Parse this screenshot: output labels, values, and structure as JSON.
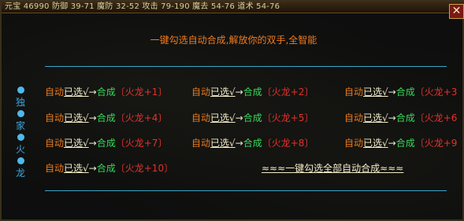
{
  "status_bar": {
    "text": "元宝  46990 防御 39-71 魔防 32-52 攻击 79-190 魔去 54-76 道术 54-76"
  },
  "close_label": "✕",
  "heading": "一键勾选自动合成,解放你的双手,全智能",
  "side_label": [
    "独",
    "家",
    "火",
    "龙"
  ],
  "rows": [
    [
      {
        "auto": "自动",
        "selected": "已选√",
        "arrow": "→",
        "combine": "合成",
        "item": "〔火龙+1〕"
      },
      {
        "auto": "自动",
        "selected": "已选√",
        "arrow": "→",
        "combine": "合成",
        "item": "〔火龙+2〕"
      },
      {
        "auto": "自动",
        "selected": "已选√",
        "arrow": "→",
        "combine": "合成",
        "item": "〔火龙+3"
      }
    ],
    [
      {
        "auto": "自动",
        "selected": "已选√",
        "arrow": "→",
        "combine": "合成",
        "item": "〔火龙+4〕"
      },
      {
        "auto": "自动",
        "selected": "已选√",
        "arrow": "→",
        "combine": "合成",
        "item": "〔火龙+5〕"
      },
      {
        "auto": "自动",
        "selected": "已选√",
        "arrow": "→",
        "combine": "合成",
        "item": "〔火龙+6"
      }
    ],
    [
      {
        "auto": "自动",
        "selected": "已选√",
        "arrow": "→",
        "combine": "合成",
        "item": "〔火龙+7〕"
      },
      {
        "auto": "自动",
        "selected": "已选√",
        "arrow": "→",
        "combine": "合成",
        "item": "〔火龙+8〕"
      },
      {
        "auto": "自动",
        "selected": "已选√",
        "arrow": "→",
        "combine": "合成",
        "item": "〔火龙+9"
      }
    ],
    [
      {
        "auto": "自动",
        "selected": "已选√",
        "arrow": "→",
        "combine": "合成",
        "item": "〔火龙+10〕"
      }
    ]
  ],
  "select_all": "≈≈≈一键勾选全部自动合成≈≈≈",
  "colors": {
    "auto": "#e87a1c",
    "selected": "#f3ecc8",
    "combine": "#38d85a",
    "item": "#e2322a",
    "accent": "#3aa6c8"
  }
}
